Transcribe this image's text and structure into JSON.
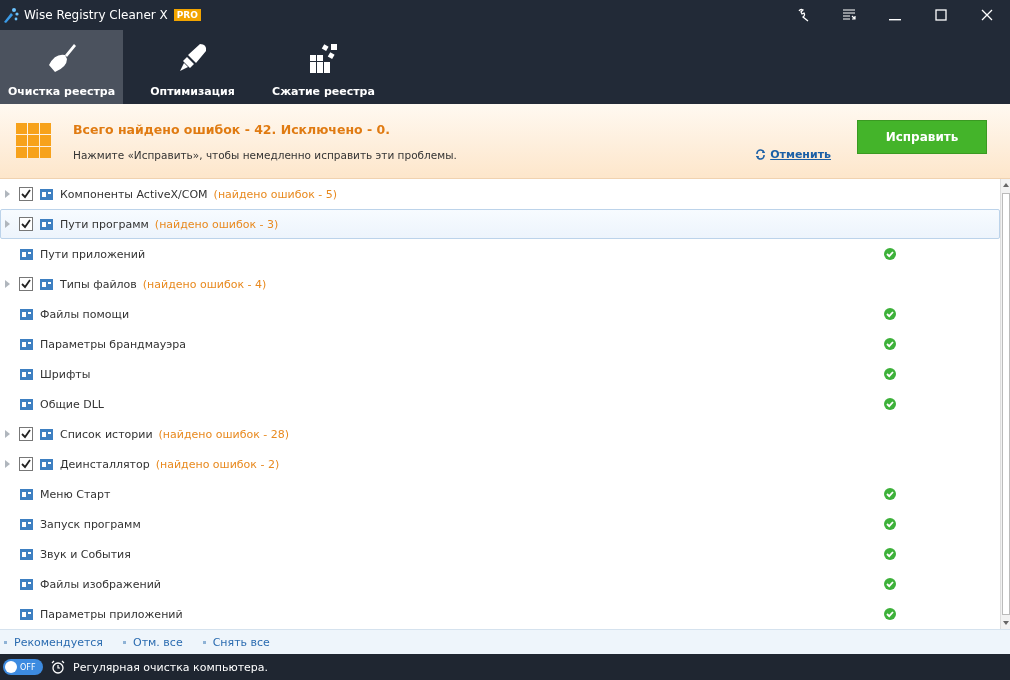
{
  "window": {
    "title": "Wise Registry Cleaner X",
    "badge": "PRO"
  },
  "tabs": [
    {
      "label": "Очистка реестра",
      "selected": true
    },
    {
      "label": "Оптимизация",
      "selected": false
    },
    {
      "label": "Сжатие реестра",
      "selected": false
    }
  ],
  "banner": {
    "headline": "Всего найдено ошибок - 42. Исключено - 0.",
    "hint": "Нажмите «Исправить», чтобы немедленно исправить эти проблемы.",
    "undo_link": "Отменить",
    "fix_button": "Исправить"
  },
  "rows": [
    {
      "kind": "issue",
      "label": "Компоненты ActiveX/COM",
      "errors": "(найдено ошибок - 5)",
      "checked": true,
      "selected": false
    },
    {
      "kind": "issue",
      "label": "Пути программ",
      "errors": "(найдено ошибок - 3)",
      "checked": true,
      "selected": true
    },
    {
      "kind": "clean",
      "label": "Пути приложений",
      "selected": false
    },
    {
      "kind": "issue",
      "label": "Типы файлов",
      "errors": "(найдено ошибок - 4)",
      "checked": true,
      "selected": false
    },
    {
      "kind": "clean",
      "label": "Файлы помощи",
      "selected": false
    },
    {
      "kind": "clean",
      "label": "Параметры брандмауэра",
      "selected": false
    },
    {
      "kind": "clean",
      "label": "Шрифты",
      "selected": false
    },
    {
      "kind": "clean",
      "label": "Общие DLL",
      "selected": false
    },
    {
      "kind": "issue",
      "label": "Список истории",
      "errors": "(найдено ошибок - 28)",
      "checked": true,
      "selected": false
    },
    {
      "kind": "issue",
      "label": "Деинсталлятор",
      "errors": "(найдено ошибок - 2)",
      "checked": true,
      "selected": false
    },
    {
      "kind": "clean",
      "label": "Меню Старт",
      "selected": false
    },
    {
      "kind": "clean",
      "label": "Запуск программ",
      "selected": false
    },
    {
      "kind": "clean",
      "label": "Звук и События",
      "selected": false
    },
    {
      "kind": "clean",
      "label": "Файлы изображений",
      "selected": false
    },
    {
      "kind": "clean",
      "label": "Параметры приложений",
      "selected": false
    }
  ],
  "footer_links": [
    "Рекомендуется",
    "Отм. все",
    "Снять все"
  ],
  "status_bar": {
    "toggle": {
      "label": "OFF",
      "on": false
    },
    "text": "Регулярная очистка компьютера."
  }
}
